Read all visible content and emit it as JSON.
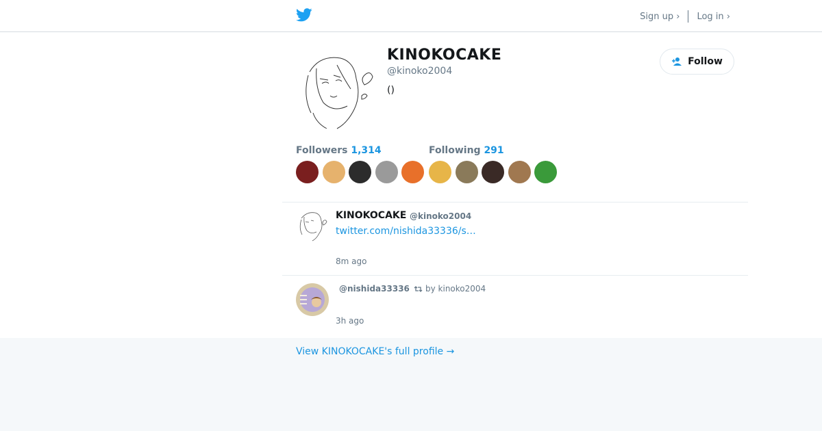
{
  "header": {
    "logo_icon": "twitter-bird-icon",
    "signup_label": "Sign up ›",
    "login_label": "Log in ›"
  },
  "profile": {
    "name": "KINOKOCAKE",
    "handle": "@kinoko2004",
    "bio": "()",
    "follow_label": "Follow",
    "follow_icon": "add-user-icon"
  },
  "stats": {
    "followers_label": "Followers",
    "followers_count": "1,314",
    "following_label": "Following",
    "following_count": "291"
  },
  "followers_avatars": [
    {
      "color": "#7a1f1f"
    },
    {
      "color": "#e6b26d"
    },
    {
      "color": "#2c2c2c"
    },
    {
      "color": "#9a9a9a"
    },
    {
      "color": "#e8702a"
    }
  ],
  "following_avatars": [
    {
      "color": "#e7b548"
    },
    {
      "color": "#8a7a5a"
    },
    {
      "color": "#3a2a26"
    },
    {
      "color": "#a07850"
    },
    {
      "color": "#3a9a3a"
    }
  ],
  "tweets": [
    {
      "name": "KINOKOCAKE",
      "handle": "@kinoko2004",
      "link": "twitter.com/nishida33336/s…",
      "time": "8m ago"
    },
    {
      "handle": "@nishida33336",
      "retweeted_by": "by kinoko2004",
      "retweet_icon": "retweet-icon",
      "time": "3h ago"
    }
  ],
  "footer": {
    "full_profile_link": "View KINOKOCAKE's full profile →"
  },
  "colors": {
    "accent": "#1b95e0",
    "bird": "#1da1f2",
    "muted": "#657786"
  }
}
